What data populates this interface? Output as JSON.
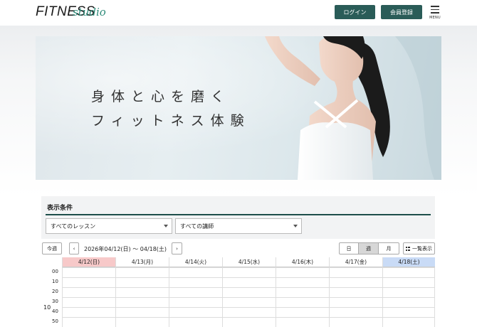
{
  "header": {
    "logo_main": "FITNESS",
    "logo_script": "studio",
    "login_label": "ログイン",
    "register_label": "会員登録",
    "menu_label": "MENU"
  },
  "hero": {
    "line1": "身体と心を磨く",
    "line2": "フィットネス体験"
  },
  "filter": {
    "title": "表示条件",
    "lesson_select": "すべてのレッスン",
    "teacher_select": "すべての講師"
  },
  "toolbar": {
    "today_label": "今週",
    "prev_label": "‹",
    "next_label": "›",
    "range": "2026年04/12(日) 〜 04/18(土)",
    "day_label": "日",
    "week_label": "週",
    "month_label": "月",
    "list_label": "一覧表示"
  },
  "calendar": {
    "days": [
      {
        "label": "4/12(日)",
        "type": "sun"
      },
      {
        "label": "4/13(月)",
        "type": "weekday"
      },
      {
        "label": "4/14(火)",
        "type": "weekday"
      },
      {
        "label": "4/15(水)",
        "type": "weekday"
      },
      {
        "label": "4/16(木)",
        "type": "weekday"
      },
      {
        "label": "4/17(金)",
        "type": "weekday"
      },
      {
        "label": "4/18(土)",
        "type": "sat"
      }
    ],
    "hour": "10",
    "minutes": [
      "00",
      "10",
      "20",
      "30",
      "40",
      "50"
    ]
  },
  "colors": {
    "accent": "#2a5c58",
    "sunday": "#f7c9c9",
    "saturday": "#c9dbf6"
  }
}
